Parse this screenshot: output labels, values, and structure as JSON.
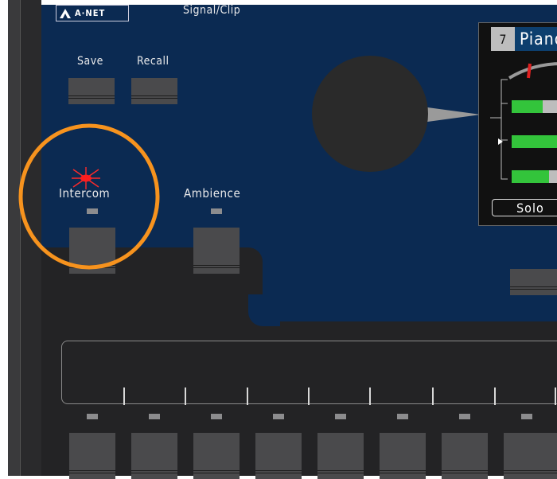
{
  "logo": {
    "text": "A·NET"
  },
  "header": {
    "signal_clip_label": "Signal/Clip"
  },
  "buttons": {
    "save_label": "Save",
    "recall_label": "Recall",
    "intercom_label": "Intercom",
    "ambience_label": "Ambience"
  },
  "display": {
    "channel_number": "7",
    "channel_name": "Piano",
    "solo_label": "Solo",
    "meter_levels": [
      0.65,
      1.0,
      0.78
    ]
  },
  "highlight": {
    "color": "#f7931e",
    "target": "intercom-button"
  },
  "colors": {
    "panel_blue": "#0b2a52",
    "dark": "#232325",
    "meter_green": "#33c43b",
    "clip_red": "#ff2a2a"
  }
}
